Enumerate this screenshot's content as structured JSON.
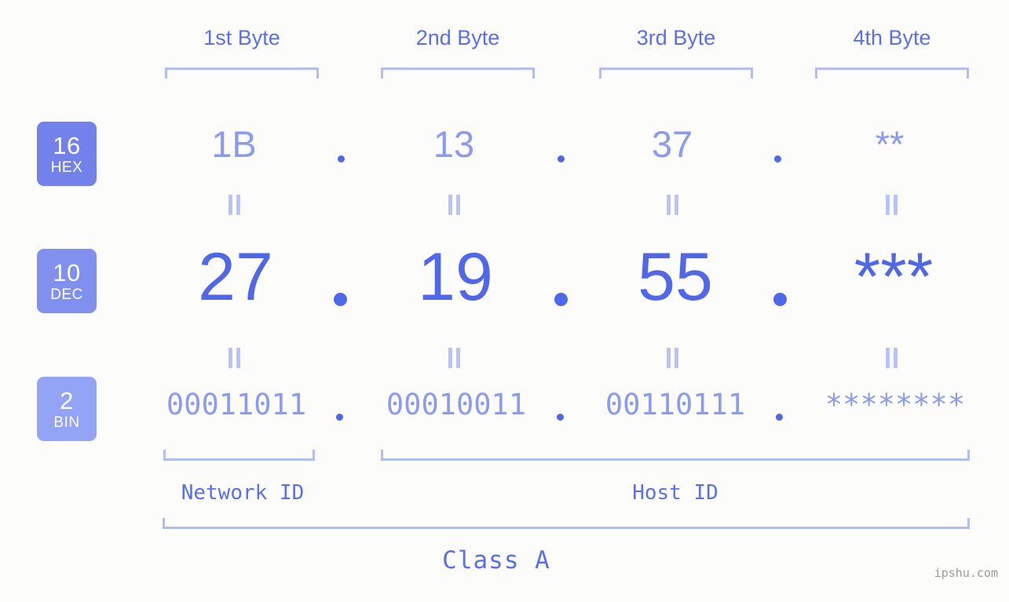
{
  "meta": {
    "watermark": "ipshu.com",
    "background_color": "#fcfdfa",
    "accent_color": "#4f67e8",
    "light_accent_color": "#8b9bf0",
    "bracket_color": "#b3bdf5"
  },
  "byte_headers": [
    {
      "label": "1st Byte"
    },
    {
      "label": "2nd Byte"
    },
    {
      "label": "3rd Byte"
    },
    {
      "label": "4th Byte"
    }
  ],
  "rows": [
    {
      "id": "hex",
      "badge_number": "16",
      "badge_abbr": "HEX",
      "badge_color": "#7282ea",
      "values": [
        "1B",
        "13",
        "37",
        "**"
      ],
      "separator": "."
    },
    {
      "id": "dec",
      "badge_number": "10",
      "badge_abbr": "DEC",
      "badge_color": "#8190ee",
      "values": [
        "27",
        "19",
        "55",
        "***"
      ],
      "separator": "."
    },
    {
      "id": "bin",
      "badge_number": "2",
      "badge_abbr": "BIN",
      "badge_color": "#93a3f5",
      "values": [
        "00011011",
        "00010011",
        "00110111",
        "********"
      ],
      "separator": "."
    }
  ],
  "equals_marks": {
    "symbol": "||",
    "count_top": 4,
    "count_bottom": 4
  },
  "id_sections": [
    {
      "label": "Network ID"
    },
    {
      "label": "Host ID"
    }
  ],
  "class": {
    "label": "Class A"
  }
}
